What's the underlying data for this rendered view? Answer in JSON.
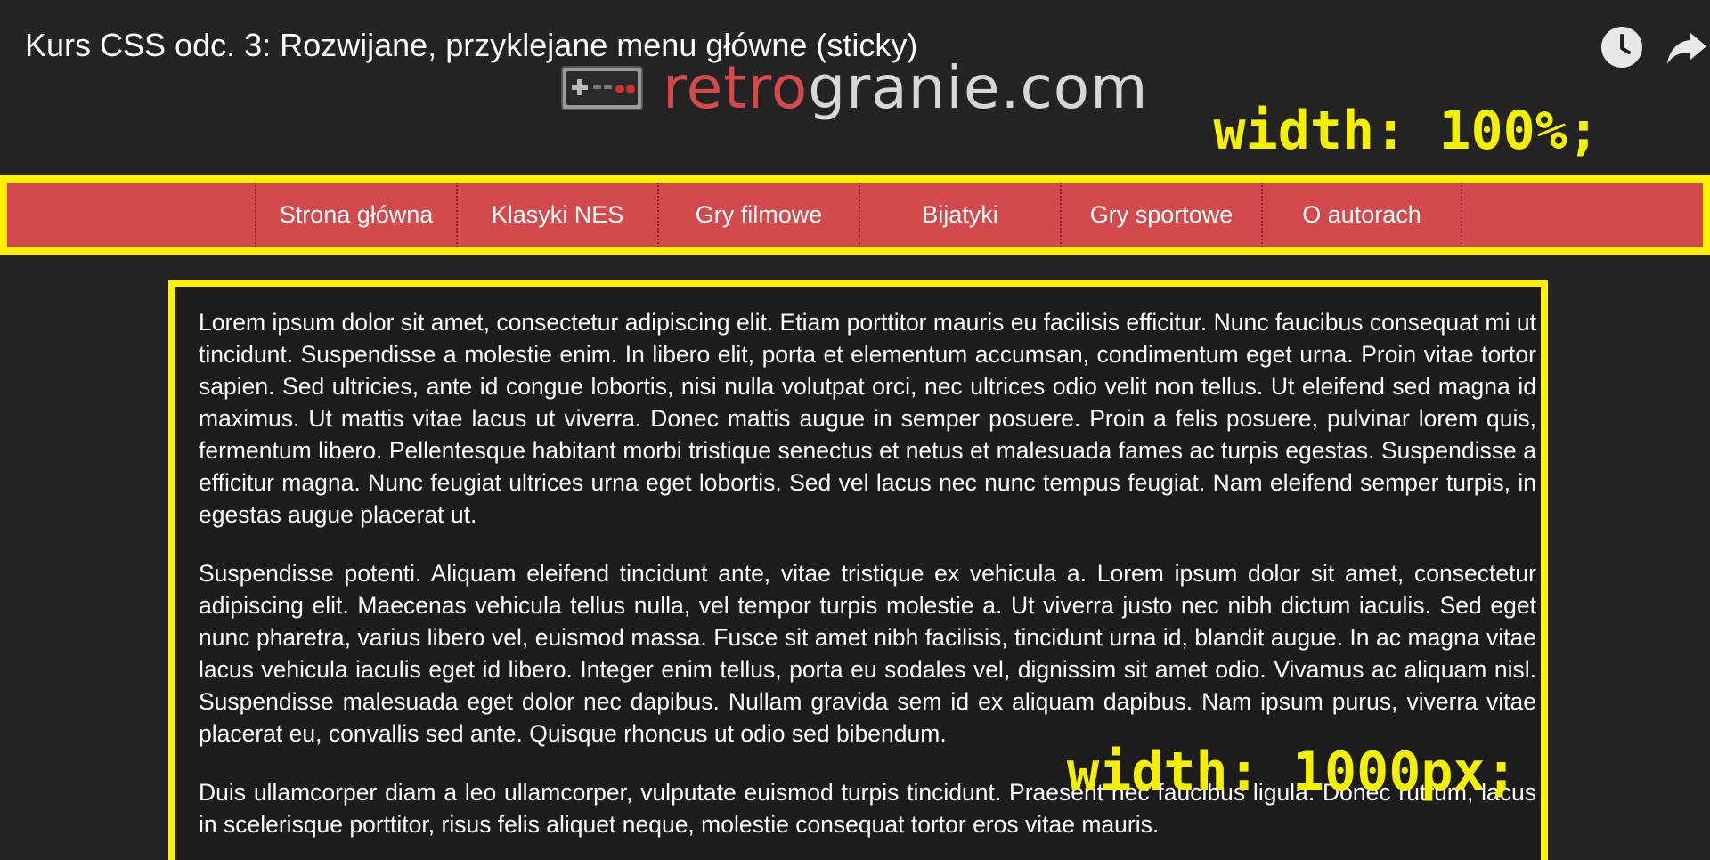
{
  "video": {
    "title": "Kurs CSS odc. 3: Rozwijane, przyklejane menu główne (sticky)"
  },
  "logo": {
    "retro": "retro",
    "granie": "granie.com"
  },
  "annotations": {
    "top": "width: 100%;",
    "bottom": "width: 1000px;"
  },
  "colors": {
    "nav_background": "#d24a4c",
    "highlight": "#fff200",
    "background": "#232323"
  },
  "nav": {
    "items": [
      {
        "label": "Strona główna"
      },
      {
        "label": "Klasyki NES"
      },
      {
        "label": "Gry filmowe"
      },
      {
        "label": "Bijatyki"
      },
      {
        "label": "Gry sportowe"
      },
      {
        "label": "O autorach"
      }
    ]
  },
  "content": {
    "paragraphs": [
      "Lorem ipsum dolor sit amet, consectetur adipiscing elit. Etiam porttitor mauris eu facilisis efficitur. Nunc faucibus consequat mi ut tincidunt. Suspendisse a molestie enim. In libero elit, porta et elementum accumsan, condimentum eget urna. Proin vitae tortor sapien. Sed ultricies, ante id congue lobortis, nisi nulla volutpat orci, nec ultrices odio velit non tellus. Ut eleifend sed magna id maximus. Ut mattis vitae lacus ut viverra. Donec mattis augue in semper posuere. Proin a felis posuere, pulvinar lorem quis, fermentum libero. Pellentesque habitant morbi tristique senectus et netus et malesuada fames ac turpis egestas. Suspendisse a efficitur magna. Nunc feugiat ultrices urna eget lobortis. Sed vel lacus nec nunc tempus feugiat. Nam eleifend semper turpis, in egestas augue placerat ut.",
      "Suspendisse potenti. Aliquam eleifend tincidunt ante, vitae tristique ex vehicula a. Lorem ipsum dolor sit amet, consectetur adipiscing elit. Maecenas vehicula tellus nulla, vel tempor turpis molestie a. Ut viverra justo nec nibh dictum iaculis. Sed eget nunc pharetra, varius libero vel, euismod massa. Fusce sit amet nibh facilisis, tincidunt urna id, blandit augue. In ac magna vitae lacus vehicula iaculis eget id libero. Integer enim tellus, porta eu sodales vel, dignissim sit amet odio. Vivamus ac aliquam nisl. Suspendisse malesuada eget dolor nec dapibus. Nullam gravida sem id ex aliquam dapibus. Nam ipsum purus, viverra vitae placerat eu, convallis sed ante. Quisque rhoncus ut odio sed bibendum.",
      "Duis ullamcorper diam a leo ullamcorper, vulputate euismod turpis tincidunt. Praesent nec faucibus ligula. Donec rutrum, lacus in scelerisque porttitor, risus felis aliquet neque, molestie consequat tortor eros vitae mauris."
    ]
  }
}
